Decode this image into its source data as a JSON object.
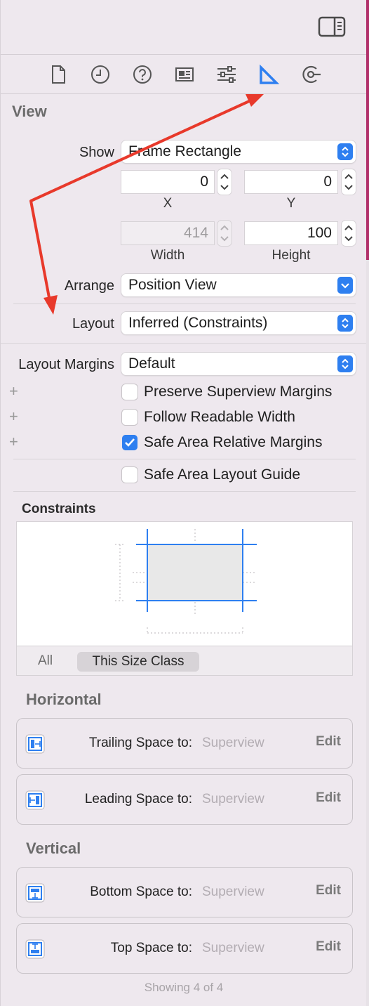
{
  "view_section": {
    "title": "View",
    "show_label": "Show",
    "show_value": "Frame Rectangle",
    "x_value": "0",
    "y_value": "0",
    "x_caption": "X",
    "y_caption": "Y",
    "width_value": "414",
    "height_value": "100",
    "width_caption": "Width",
    "height_caption": "Height",
    "arrange_label": "Arrange",
    "arrange_value": "Position View",
    "layout_label": "Layout",
    "layout_value": "Inferred (Constraints)",
    "layout_margins_label": "Layout Margins",
    "layout_margins_value": "Default",
    "checkboxes": [
      {
        "label": "Preserve Superview Margins",
        "checked": false
      },
      {
        "label": "Follow Readable Width",
        "checked": false
      },
      {
        "label": "Safe Area Relative Margins",
        "checked": true
      },
      {
        "label": "Safe Area Layout Guide",
        "checked": false
      }
    ],
    "plus_glyph": "+"
  },
  "constraints": {
    "title": "Constraints",
    "size_all": "All",
    "size_class": "This Size Class"
  },
  "horizontal": {
    "title": "Horizontal",
    "items": [
      {
        "label": "Trailing Space to:",
        "target": "Superview",
        "edit": "Edit"
      },
      {
        "label": "Leading Space to:",
        "target": "Superview",
        "edit": "Edit"
      }
    ]
  },
  "vertical": {
    "title": "Vertical",
    "items": [
      {
        "label": "Bottom Space to:",
        "target": "Superview",
        "edit": "Edit"
      },
      {
        "label": "Top Space to:",
        "target": "Superview",
        "edit": "Edit"
      }
    ]
  },
  "footer": "Showing 4 of 4",
  "colors": {
    "accent": "#2e7ff0",
    "annotation": "#e8392b"
  },
  "tabs": [
    "file-icon",
    "history-icon",
    "help-icon",
    "identity-icon",
    "attributes-icon",
    "size-icon",
    "connections-icon"
  ]
}
